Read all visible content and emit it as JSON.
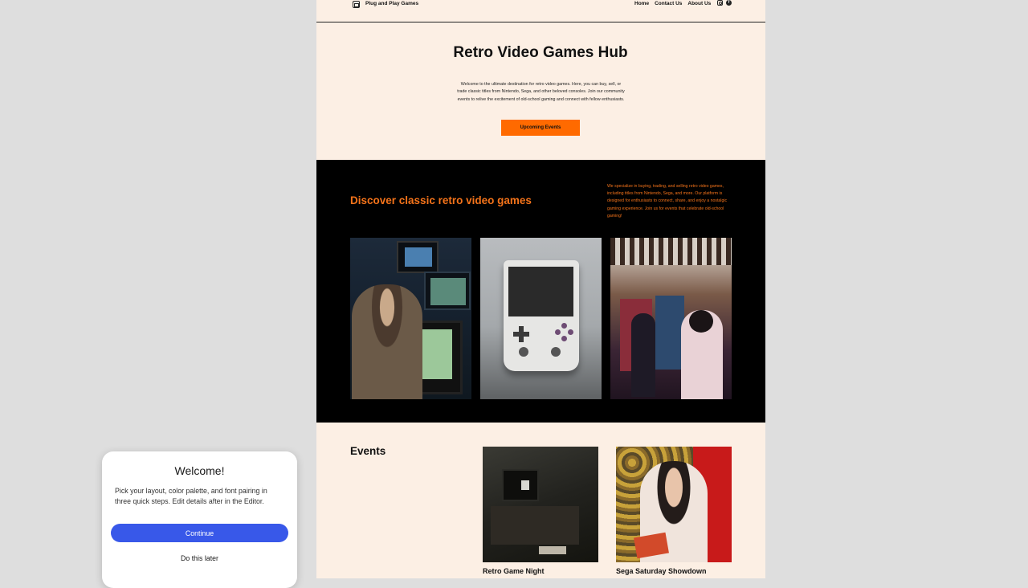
{
  "header": {
    "site_title": "Plug and Play Games",
    "logo_icon": "site-logo-icon",
    "nav": [
      "Home",
      "Contact Us",
      "About Us"
    ],
    "social_icons": [
      "instagram-icon",
      "facebook-icon"
    ]
  },
  "hero": {
    "title": "Retro Video Games Hub",
    "text": "Welcome to the ultimate destination for retro video games. Here, you can buy, sell, or trade classic titles from Nintendo, Sega, and other beloved consoles. Join our community events to relive the excitement of old-school gaming and connect with fellow enthusiasts.",
    "button": "Upcoming Events"
  },
  "discover": {
    "title": "Discover classic retro video games",
    "text": "We specialize in buying, trading, and selling retro video games, including titles from Nintendo, Sega, and more. Our platform is designed for enthusiasts to connect, share, and enjoy a nostalgic gaming experience. Join us for events that celebrate old-school gaming!"
  },
  "events": {
    "title": "Events",
    "items": [
      {
        "title": "Retro Game Night"
      },
      {
        "title": "Sega Saturday Showdown"
      }
    ]
  },
  "modal": {
    "title": "Welcome!",
    "text": "Pick your layout, color palette, and font pairing in three quick steps. Edit details after in the Editor.",
    "continue": "Continue",
    "later": "Do this later"
  },
  "colors": {
    "accent": "#ff6a00",
    "accent_text": "#f4731a",
    "page_bg": "#fcefe4",
    "dark_bg": "#000000",
    "modal_button": "#3858e9"
  }
}
